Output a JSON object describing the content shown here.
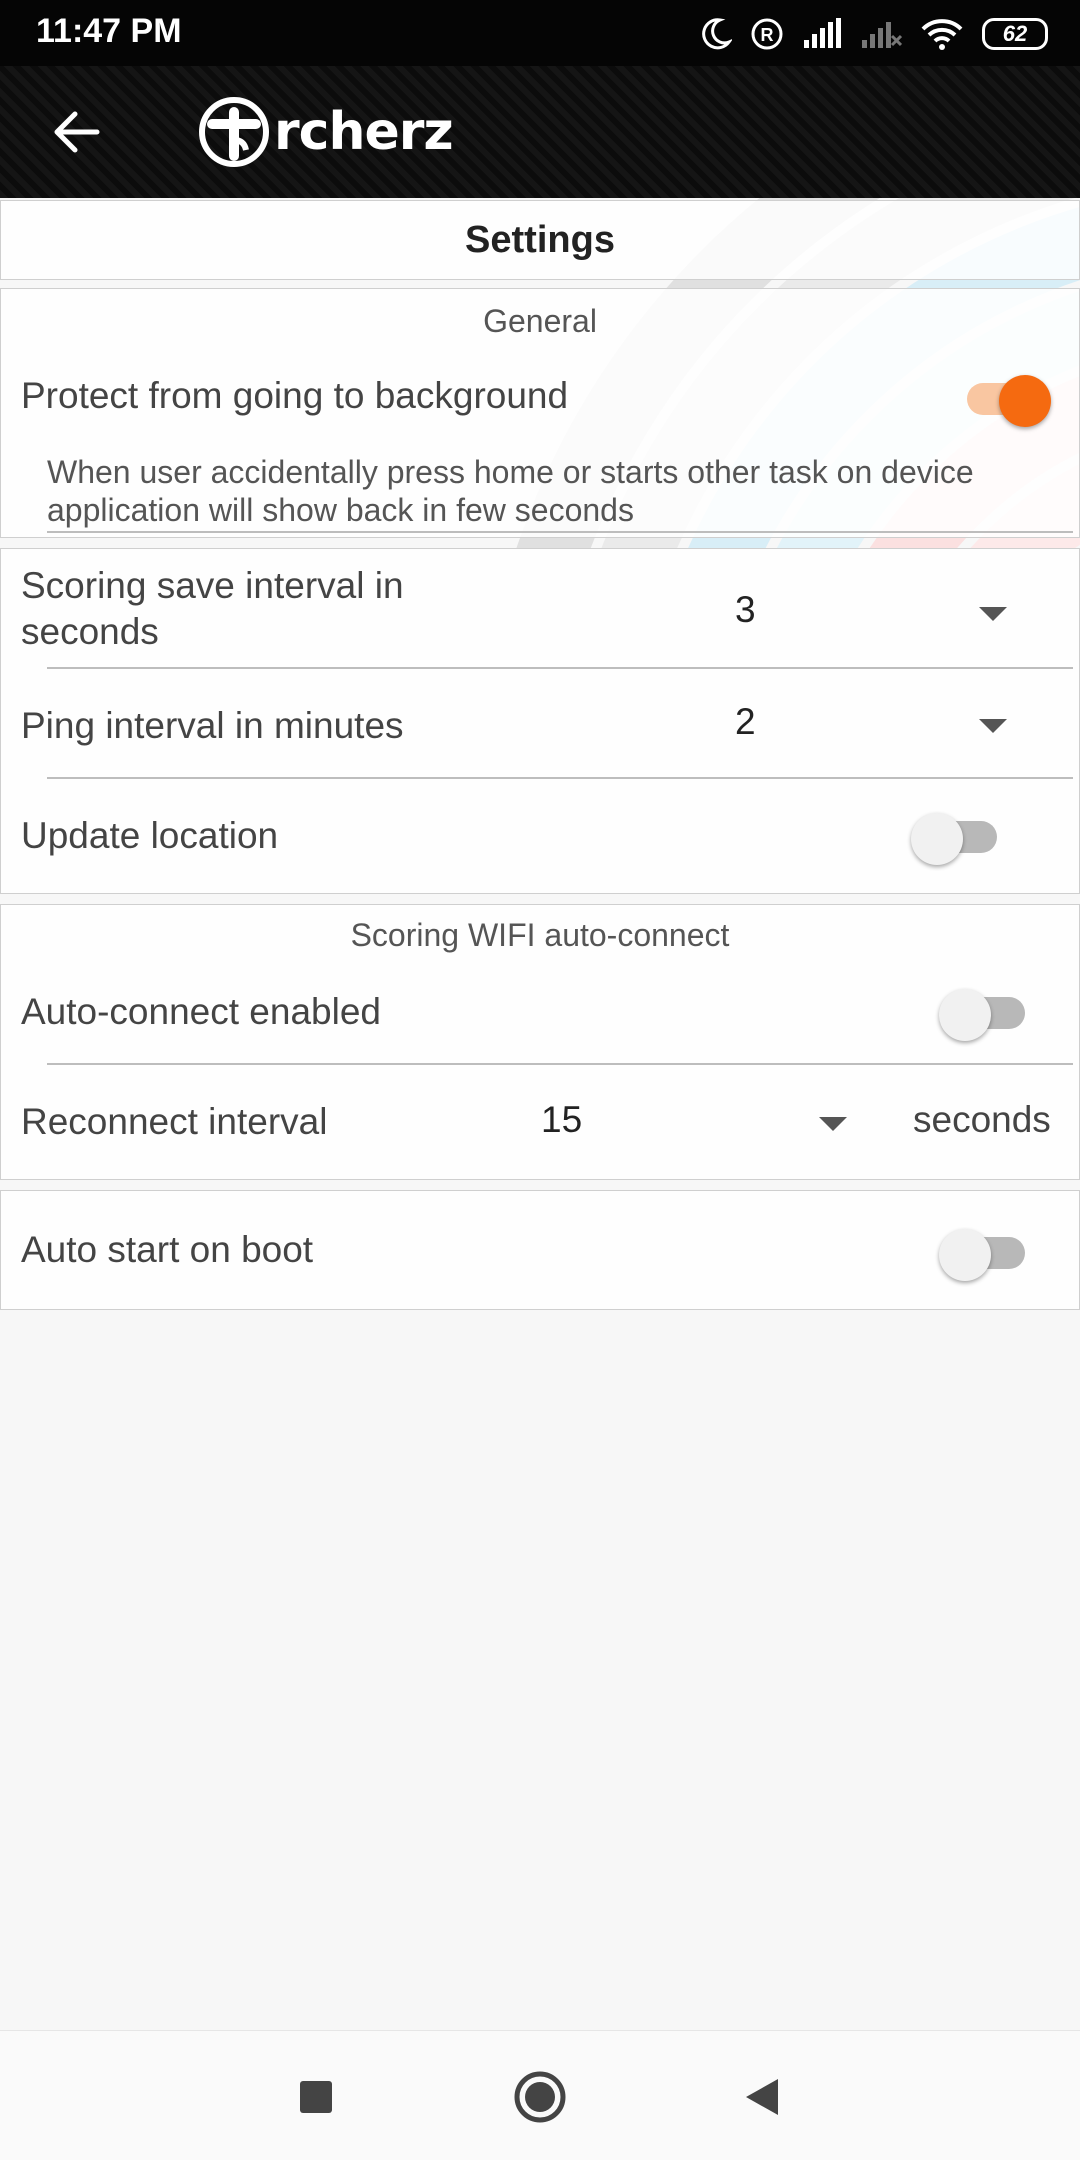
{
  "status_bar": {
    "time": "11:47 PM",
    "battery": "62",
    "icons": [
      "moon-icon",
      "registered-icon",
      "signal-icon",
      "signal-no-icon",
      "wifi-icon",
      "battery-icon"
    ]
  },
  "app_bar": {
    "back_icon": "arrow-left-icon",
    "logo_text": "rcherz"
  },
  "page": {
    "title": "Settings"
  },
  "general": {
    "header": "General",
    "protect_label": "Protect from going to background",
    "protect_on": true,
    "protect_desc": "When user accidentally press home or starts other task on device application will show back in few seconds"
  },
  "intervals": {
    "scoring_label": "Scoring save interval in seconds",
    "scoring_value": "3",
    "ping_label": "Ping interval in minutes",
    "ping_value": "2",
    "location_label": "Update location",
    "location_on": false
  },
  "wifi": {
    "header": "Scoring WIFI auto-connect",
    "autoconnect_label": "Auto-connect enabled",
    "autoconnect_on": false,
    "reconnect_label": "Reconnect interval",
    "reconnect_value": "15",
    "reconnect_unit": "seconds"
  },
  "boot": {
    "label": "Auto start on boot",
    "on": false
  },
  "colors": {
    "accent": "#f56a10",
    "accent_track": "#f9c6a1",
    "app_bar": "#111111"
  },
  "nav_bar": {
    "icons": [
      "square-icon",
      "circle-icon",
      "triangle-back-icon"
    ]
  }
}
